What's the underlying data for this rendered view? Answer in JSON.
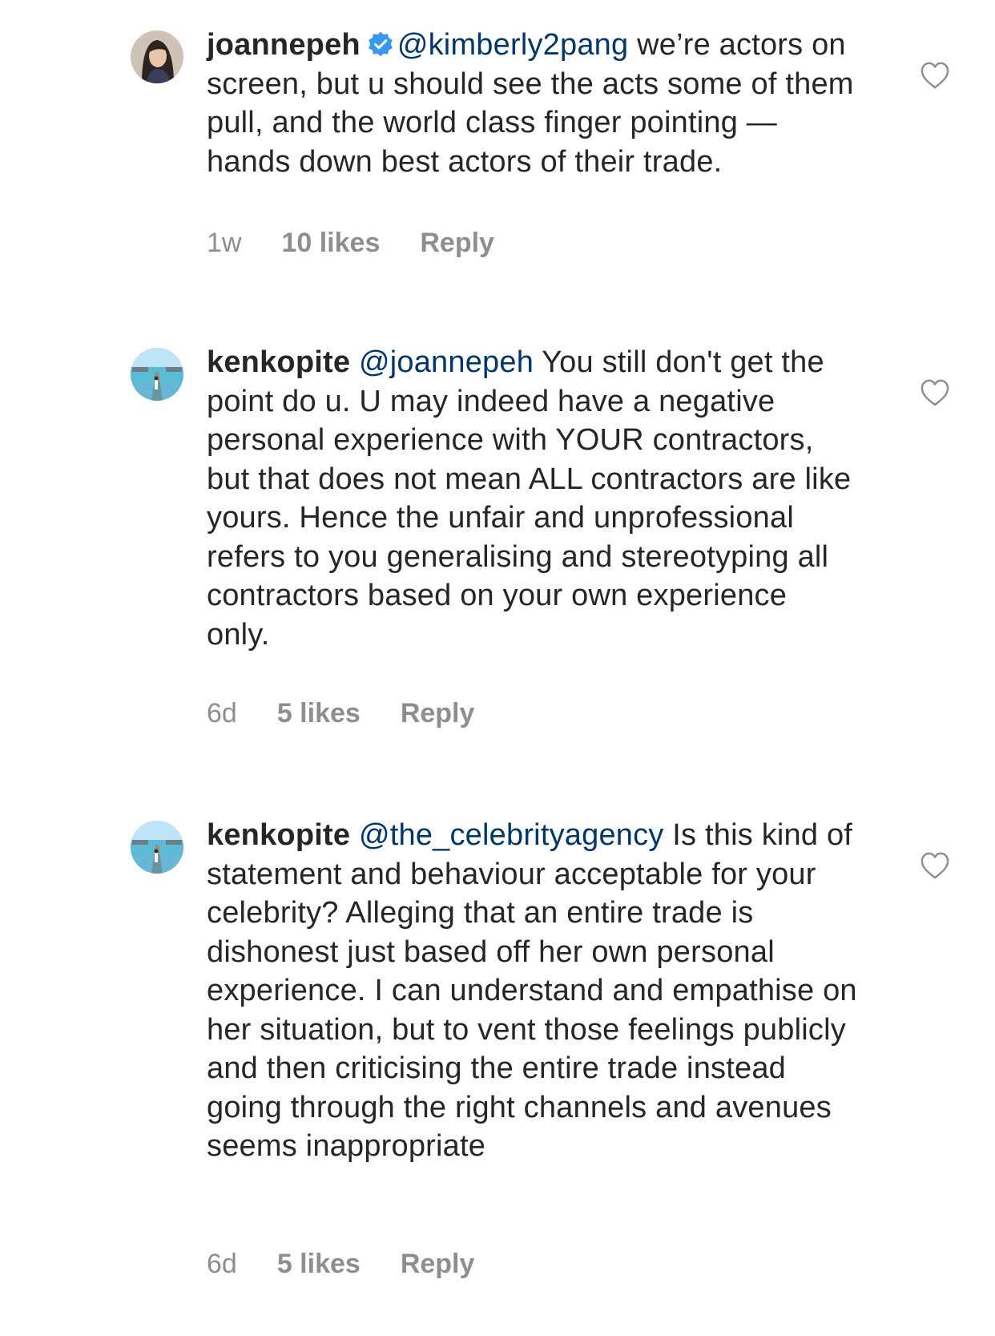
{
  "comments": [
    {
      "username": "joannepeh",
      "verified": true,
      "mention": "@kimberly2pang",
      "text": " we’re actors on screen, but u should see the acts some of them pull, and the world class finger pointing — hands down best actors of their trade.",
      "time": "1w",
      "likes": "10 likes",
      "reply_label": "Reply",
      "avatar_icon": "woman-portrait-avatar"
    },
    {
      "username": "kenkopite",
      "verified": false,
      "mention": "@joannepeh",
      "text": " You still don't get the point do u. U may indeed have a negative personal experience with YOUR contractors, but that does not mean ALL contractors are like yours. Hence the unfair and unprofessional  refers to you generalising and stereotyping all contractors based on your own experience only.",
      "time": "6d",
      "likes": "5 likes",
      "reply_label": "Reply",
      "avatar_icon": "beach-pier-avatar"
    },
    {
      "username": "kenkopite",
      "verified": false,
      "mention": "@the_celebrityagency",
      "text": " Is this kind of statement and behaviour acceptable for your celebrity? Alleging that an entire trade is dishonest just based off her own personal experience. I can understand and empathise on her situation, but to vent those feelings publicly and then criticising the entire trade instead going through the right channels and avenues seems inappropriate",
      "time": "6d",
      "likes": "5 likes",
      "reply_label": "Reply",
      "avatar_icon": "beach-pier-avatar"
    }
  ],
  "colors": {
    "text": "#262626",
    "mention": "#00376b",
    "meta": "#8e8e8e",
    "verified_badge": "#3897f0"
  }
}
